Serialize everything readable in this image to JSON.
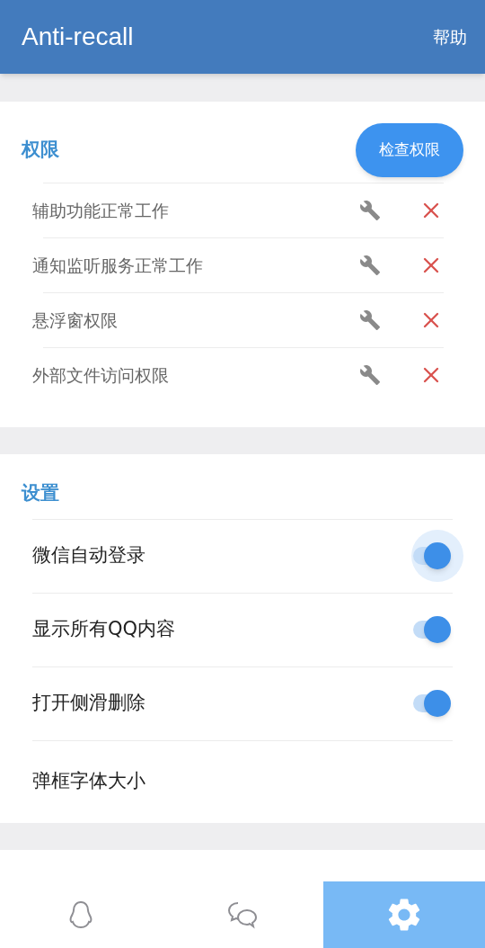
{
  "app_bar": {
    "title": "Anti-recall",
    "action": "帮助"
  },
  "permissions": {
    "title": "权限",
    "button": "检查权限",
    "items": [
      {
        "label": "辅助功能正常工作",
        "granted": false
      },
      {
        "label": "通知监听服务正常工作",
        "granted": false
      },
      {
        "label": "悬浮窗权限",
        "granted": false
      },
      {
        "label": "外部文件访问权限",
        "granted": false
      }
    ]
  },
  "settings": {
    "title": "设置",
    "items": [
      {
        "kind": "switch",
        "label": "微信自动登录",
        "on": true,
        "focused": true
      },
      {
        "kind": "switch",
        "label": "显示所有QQ内容",
        "on": true,
        "focused": false
      },
      {
        "kind": "switch",
        "label": "打开侧滑删除",
        "on": true,
        "focused": false
      },
      {
        "kind": "action",
        "label": "弹框字体大小"
      }
    ]
  },
  "bottom_nav": [
    {
      "kind": "qq",
      "selected": false
    },
    {
      "kind": "wechat",
      "selected": false
    },
    {
      "kind": "settings",
      "selected": true
    }
  ]
}
